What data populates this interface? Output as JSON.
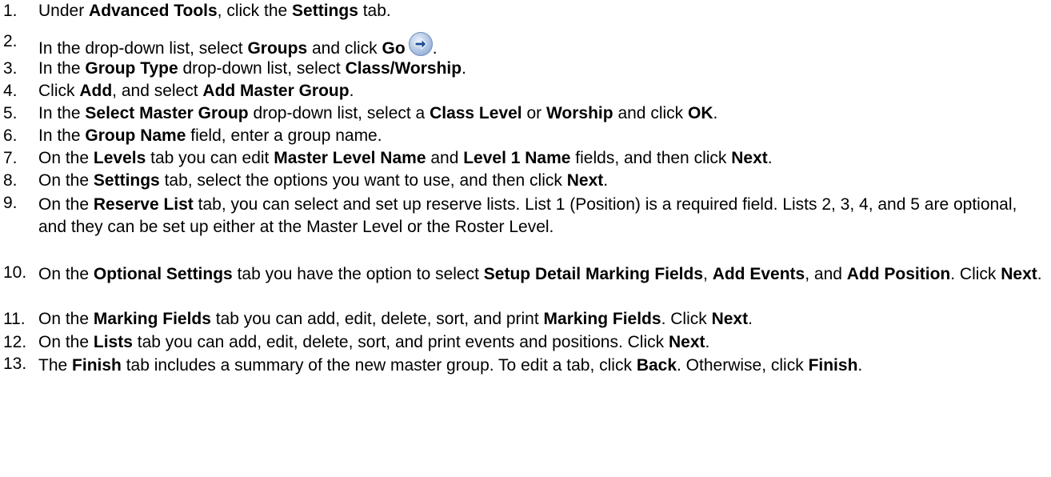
{
  "steps": [
    {
      "num": "1.",
      "parts": [
        [
          "Under ",
          0
        ],
        [
          "Advanced Tools",
          1
        ],
        [
          ", click the ",
          0
        ],
        [
          "Settings",
          1
        ],
        [
          " tab.",
          0
        ]
      ]
    },
    {
      "num": "2.",
      "parts": [
        [
          "In the drop-down list, select ",
          0
        ],
        [
          "Groups",
          1
        ],
        [
          " and click ",
          0
        ],
        [
          "Go",
          1
        ]
      ],
      "icon": "go-arrow-icon",
      "after_icon": "."
    },
    {
      "num": "3.",
      "parts": [
        [
          "In the ",
          0
        ],
        [
          "Group Type",
          1
        ],
        [
          " drop-down list, select ",
          0
        ],
        [
          "Class/Worship",
          1
        ],
        [
          ".",
          0
        ]
      ]
    },
    {
      "num": "4.",
      "parts": [
        [
          "Click ",
          0
        ],
        [
          "Add",
          1
        ],
        [
          ", and select ",
          0
        ],
        [
          "Add Master Group",
          1
        ],
        [
          ".",
          0
        ]
      ]
    },
    {
      "num": "5.",
      "parts": [
        [
          "In the ",
          0
        ],
        [
          "Select Master Group",
          1
        ],
        [
          " drop-down list, select a ",
          0
        ],
        [
          "Class Level",
          1
        ],
        [
          " or ",
          0
        ],
        [
          "Worship",
          1
        ],
        [
          " and click ",
          0
        ],
        [
          "OK",
          1
        ],
        [
          ".",
          0
        ]
      ]
    },
    {
      "num": "6.",
      "parts": [
        [
          "In the ",
          0
        ],
        [
          "Group Name",
          1
        ],
        [
          " field, enter a group name.",
          0
        ]
      ]
    },
    {
      "num": "7.",
      "parts": [
        [
          "On the ",
          0
        ],
        [
          "Levels",
          1
        ],
        [
          " tab you can edit ",
          0
        ],
        [
          "Master Level Name",
          1
        ],
        [
          " and ",
          0
        ],
        [
          "Level 1 Name",
          1
        ],
        [
          " fields, and then click ",
          0
        ],
        [
          "Next",
          1
        ],
        [
          ".",
          0
        ]
      ]
    },
    {
      "num": "8.",
      "parts": [
        [
          "On the ",
          0
        ],
        [
          "Settings",
          1
        ],
        [
          " tab, select the options you want to use, and then click ",
          0
        ],
        [
          "Next",
          1
        ],
        [
          ".",
          0
        ]
      ]
    },
    {
      "num": "9.",
      "parts": [
        [
          "On the ",
          0
        ],
        [
          "Reserve List",
          1
        ],
        [
          " tab, you can select and set up reserve lists.  List 1 (Position) is a required field. Lists 2, 3, 4, and 5 are optional, and they can be set up either at the Master Level or the Roster Level.",
          0
        ]
      ]
    },
    {
      "num": "10.",
      "parts": [
        [
          "On the ",
          0
        ],
        [
          "Optional Settings",
          1
        ],
        [
          " tab you have the option to select ",
          0
        ],
        [
          "Setup Detail Marking Fields",
          1
        ],
        [
          ", ",
          0
        ],
        [
          "Add Events",
          1
        ],
        [
          ", and ",
          0
        ],
        [
          "Add Position",
          1
        ],
        [
          ". Click ",
          0
        ],
        [
          "Next",
          1
        ],
        [
          ".",
          0
        ]
      ]
    },
    {
      "num": "11.",
      "parts": [
        [
          "On the ",
          0
        ],
        [
          "Marking Fields",
          1
        ],
        [
          " tab you can add, edit, delete, sort, and print ",
          0
        ],
        [
          "Marking Fields",
          1
        ],
        [
          ". Click ",
          0
        ],
        [
          "Next",
          1
        ],
        [
          ".",
          0
        ]
      ]
    },
    {
      "num": "12.",
      "parts": [
        [
          "On the ",
          0
        ],
        [
          "Lists",
          1
        ],
        [
          " tab you can add, edit, delete, sort, and print events and positions. Click ",
          0
        ],
        [
          "Next",
          1
        ],
        [
          ".",
          0
        ]
      ]
    },
    {
      "num": "13.",
      "parts": [
        [
          "The ",
          0
        ],
        [
          "Finish",
          1
        ],
        [
          " tab includes a summary of the new master group. To edit a tab, click ",
          0
        ],
        [
          "Back",
          1
        ],
        [
          ". Otherwise, click ",
          0
        ],
        [
          "Finish",
          1
        ],
        [
          ".",
          0
        ]
      ]
    }
  ],
  "colors": {
    "text": "#000000",
    "go_icon_fill": "#b8cce8",
    "go_icon_arrow": "#1f4f9a"
  }
}
